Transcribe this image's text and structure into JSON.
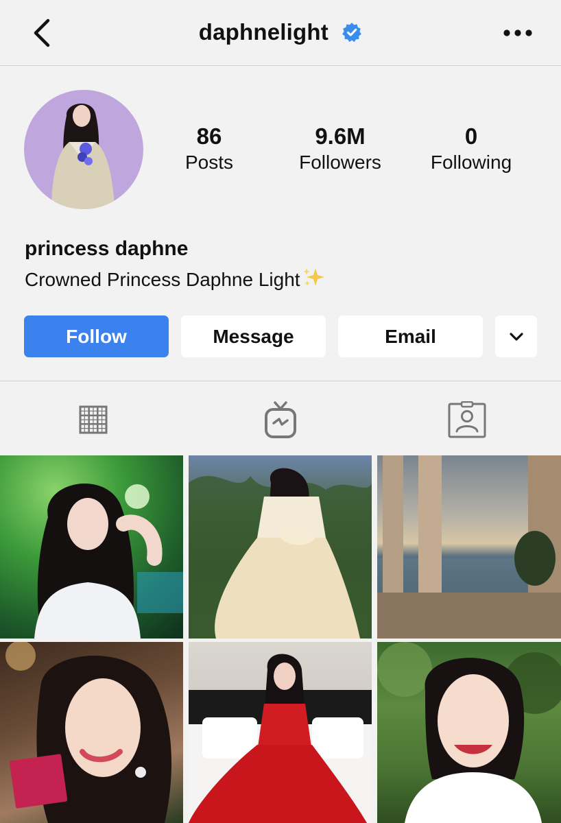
{
  "header": {
    "username": "daphnelight",
    "verified": true,
    "back_icon": "chevron-left-icon",
    "more_icon": "more-horizontal-icon"
  },
  "profile": {
    "stats": [
      {
        "value": "86",
        "label": "Posts"
      },
      {
        "value": "9.6M",
        "label": "Followers"
      },
      {
        "value": "0",
        "label": "Following"
      }
    ],
    "display_name": "princess daphne",
    "bio": "Crowned Princess Daphne Light"
  },
  "actions": {
    "follow_label": "Follow",
    "message_label": "Message",
    "email_label": "Email",
    "more_icon": "chevron-down-icon"
  },
  "tabs": [
    {
      "icon": "grid-icon",
      "active": true
    },
    {
      "icon": "igtv-icon",
      "active": false
    },
    {
      "icon": "tagged-icon",
      "active": false
    }
  ],
  "colors": {
    "follow_button": "#3b82ee",
    "verified_badge": "#3b8ded",
    "background": "#f2f2f2"
  },
  "posts": [
    {
      "description": "stage-performance-green-light"
    },
    {
      "description": "cream-ballgown-in-garden"
    },
    {
      "description": "stone-columns-sea-sunset"
    },
    {
      "description": "portrait-christmas-tree"
    },
    {
      "description": "red-dress-on-bed"
    },
    {
      "description": "smiling-portrait-greenery"
    }
  ]
}
